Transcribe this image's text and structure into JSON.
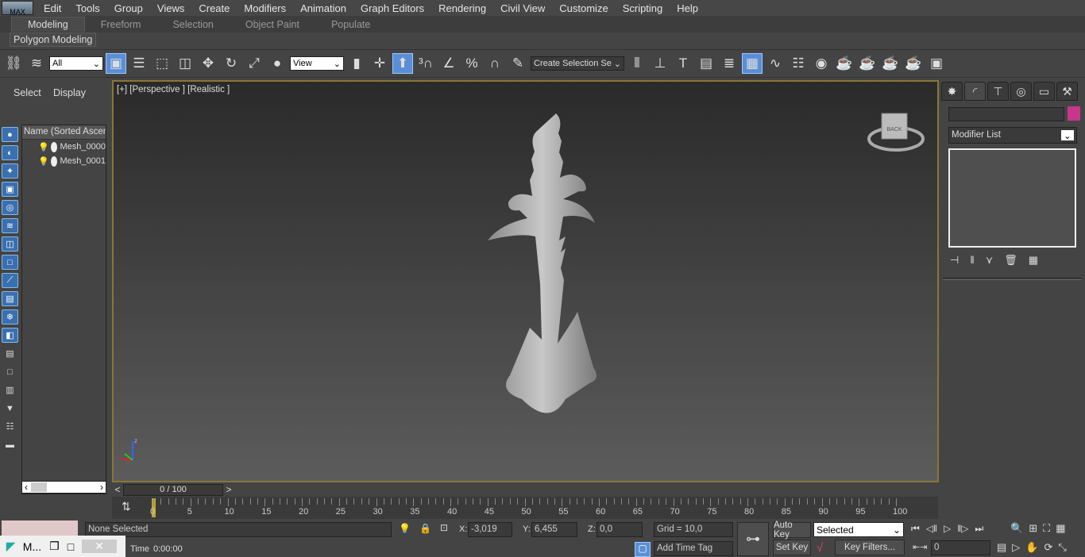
{
  "menubar": {
    "logo": "MAX",
    "items": [
      "Edit",
      "Tools",
      "Group",
      "Views",
      "Create",
      "Modifiers",
      "Animation",
      "Graph Editors",
      "Rendering",
      "Civil View",
      "Customize",
      "Scripting",
      "Help"
    ]
  },
  "ribbon": {
    "tabs": [
      "Modeling",
      "Freeform",
      "Selection",
      "Object Paint",
      "Populate"
    ],
    "active": "Modeling",
    "sub_label": "Polygon Modeling"
  },
  "toolbar": {
    "filter_select": "All",
    "coord_select": "View",
    "named_selection": "Create Selection Se"
  },
  "left_panel": {
    "tabs": [
      "Select",
      "Display"
    ],
    "column_header": "Name (Sorted Ascending)",
    "items": [
      "Mesh_0000",
      "Mesh_0001"
    ]
  },
  "viewport": {
    "label": "[+] [Perspective ] [Realistic ]",
    "viewcube": "BACK"
  },
  "command_panel": {
    "name_value": "",
    "object_color": "#c8368c",
    "modifier_list": "Modifier List"
  },
  "time_slider": {
    "value": "0 / 100",
    "prev": "<",
    "next": ">"
  },
  "timeline": {
    "ticks": [
      "0",
      "5",
      "10",
      "15",
      "20",
      "25",
      "30",
      "35",
      "40",
      "45",
      "50",
      "55",
      "60",
      "65",
      "70",
      "75",
      "80",
      "85",
      "90",
      "95",
      "100"
    ]
  },
  "status": {
    "selection": "None Selected",
    "x_label": "X:",
    "x": "-3,019",
    "y_label": "Y:",
    "y": "6,455",
    "z_label": "Z:",
    "z": "0,0",
    "grid": "Grid = 10,0",
    "add_time_tag": "Add Time Tag",
    "time_prefix": "Time",
    "time": "0:00:00",
    "auto_key": "Auto Key",
    "set_key": "Set Key",
    "key_mode": "Selected",
    "key_filters": "Key Filters...",
    "current_frame": "0"
  },
  "taskbar": {
    "label": "M..."
  },
  "colors": {
    "viewport_border": "#8a7636",
    "active_button": "#5b8ed6"
  }
}
